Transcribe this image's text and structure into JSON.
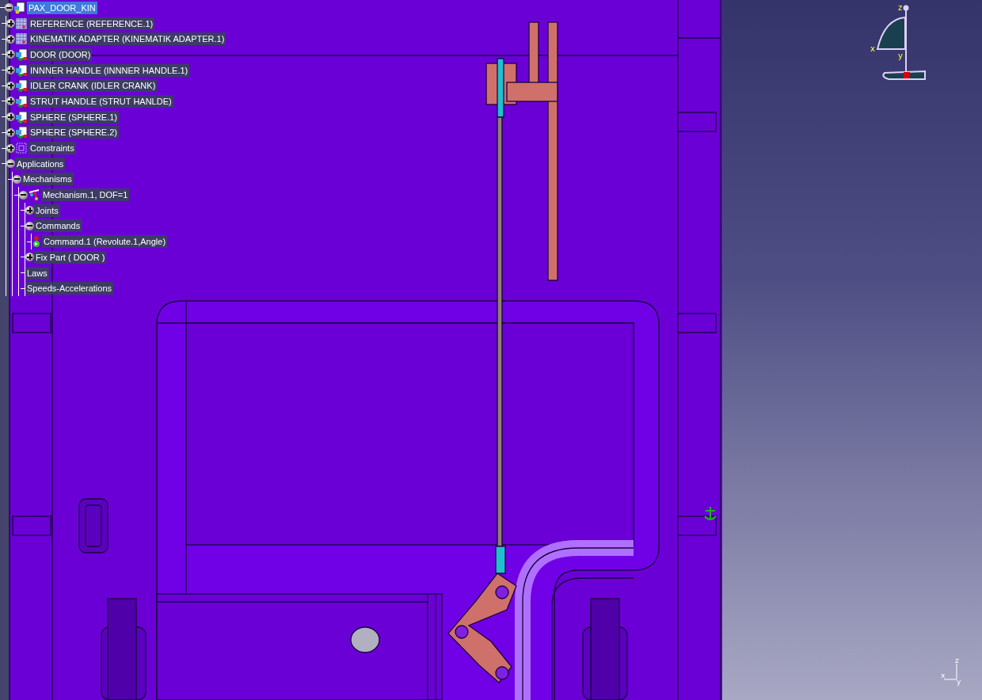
{
  "tree": [
    {
      "label": "PAX_DOOR_KIN",
      "kind": "product",
      "expanded": true,
      "selected": true,
      "children": [
        {
          "label": "REFERENCE (REFERENCE.1)",
          "kind": "component",
          "expanded": false,
          "selected": false
        },
        {
          "label": "KINEMATIK ADAPTER (KINEMATIK ADAPTER.1)",
          "kind": "component",
          "expanded": false,
          "selected": false
        },
        {
          "label": "DOOR (DOOR)",
          "kind": "part",
          "expanded": false,
          "selected": false
        },
        {
          "label": "INNNER HANDLE (INNNER HANDLE.1)",
          "kind": "part",
          "expanded": false,
          "selected": false
        },
        {
          "label": "IDLER CRANK (IDLER CRANK)",
          "kind": "part",
          "expanded": false,
          "selected": false
        },
        {
          "label": "STRUT HANDLE (STRUT HANLDE)",
          "kind": "part",
          "expanded": false,
          "selected": false
        },
        {
          "label": "SPHERE (SPHERE.1)",
          "kind": "part",
          "expanded": false,
          "selected": false
        },
        {
          "label": "SPHERE (SPHERE.2)",
          "kind": "part",
          "expanded": false,
          "selected": false
        },
        {
          "label": "Constraints",
          "kind": "constraints",
          "expanded": false,
          "selected": false
        },
        {
          "label": "Applications",
          "expanded": true,
          "selected": false,
          "children": [
            {
              "label": "Mechanisms",
              "expanded": true,
              "selected": false,
              "children": [
                {
                  "label": "Mechanism.1, DOF=1",
                  "kind": "mechanism",
                  "expanded": true,
                  "selected": false,
                  "children": [
                    {
                      "label": "Joints",
                      "expanded": false,
                      "selected": false
                    },
                    {
                      "label": "Commands",
                      "expanded": true,
                      "selected": false,
                      "children": [
                        {
                          "label": "Command.1 (Revolute.1,Angle)",
                          "kind": "command",
                          "selected": false
                        }
                      ]
                    },
                    {
                      "label": "Fix Part ( DOOR )",
                      "expanded": false,
                      "selected": false
                    },
                    {
                      "label": "Laws",
                      "selected": false
                    },
                    {
                      "label": "Speeds-Accelerations",
                      "selected": false
                    }
                  ]
                }
              ]
            }
          ]
        }
      ]
    }
  ],
  "compass": {
    "axes": [
      "z",
      "x",
      "y"
    ]
  },
  "mini_axis": {
    "axes": [
      "z",
      "x",
      "y"
    ]
  }
}
